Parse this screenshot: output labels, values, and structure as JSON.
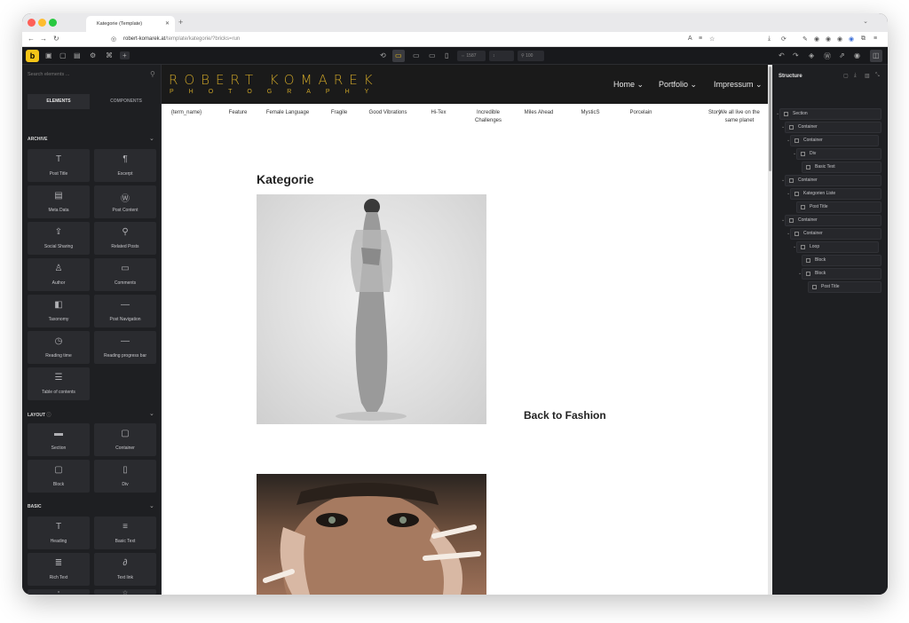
{
  "browser": {
    "tab_title": "Kategorie (Template)",
    "url_host": "robert-komarek.at",
    "url_path": "/template/kategorie/?bricks=run"
  },
  "toolbar": {
    "width_value": "1587",
    "zoom_value": "100"
  },
  "left_panel": {
    "search_placeholder": "Search elements ...",
    "tabs": [
      "ELEMENTS",
      "COMPONENTS"
    ],
    "archive": {
      "title": "ARCHIVE",
      "items": [
        "Post Title",
        "Excerpt",
        "Meta Data",
        "Post Content",
        "Social Sharing",
        "Related Posts",
        "Author",
        "Comments",
        "Taxonomy",
        "Post Navigation",
        "Reading time",
        "Reading progress bar",
        "Table of contents"
      ]
    },
    "layout": {
      "title": "LAYOUT",
      "items": [
        "Section",
        "Container",
        "Block",
        "Div"
      ]
    },
    "basic": {
      "title": "BASIC",
      "items": [
        "Heading",
        "Basic Text",
        "Rich Text",
        "Text link",
        "",
        ""
      ]
    }
  },
  "site": {
    "brand_name": "ROBERT KOMAREK",
    "brand_sub": "PHOTOGRAPHY",
    "menu": [
      "Home",
      "Portfolio",
      "Impressum"
    ],
    "categories": [
      "{term_name}",
      "Feature",
      "Female Language",
      "Fragile",
      "Good Vibrations",
      "Hi-Tex",
      "Incredible Challenges",
      "Miles Ahead",
      "MysticS",
      "Porcelain",
      "Story",
      "We all live on the same planet"
    ],
    "page_title": "Kategorie",
    "post_title": "Back to Fashion"
  },
  "structure": {
    "title": "Structure",
    "rows": [
      "Section",
      "Container",
      "Container",
      "Div",
      "Basic Text",
      "Container",
      "Kategorien Liste",
      "Post Title",
      "Container",
      "Container",
      "Loop",
      "Block",
      "Block",
      "Post Title"
    ]
  }
}
